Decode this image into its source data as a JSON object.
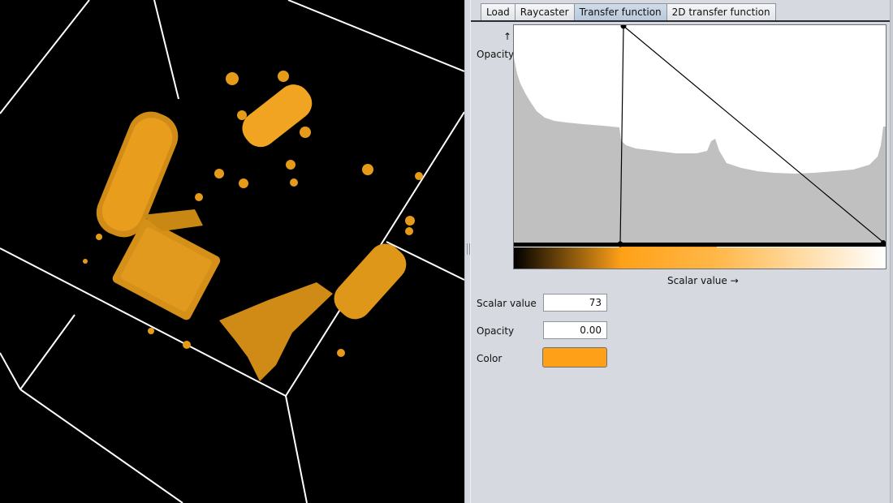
{
  "tabs": [
    {
      "label": "Load",
      "active": false
    },
    {
      "label": "Raycaster",
      "active": false
    },
    {
      "label": "Transfer function",
      "active": true
    },
    {
      "label": "2D transfer function",
      "active": false
    }
  ],
  "tf_editor": {
    "y_arrow": "↑",
    "y_label": "Opacity",
    "x_label": "Scalar value →"
  },
  "controls": {
    "scalar_label": "Scalar value",
    "scalar_value": "73",
    "opacity_label": "Opacity",
    "opacity_value": "0.00",
    "color_label": "Color",
    "color_hex": "#ffa118"
  },
  "colors": {
    "volume": "#e69a1a",
    "histogram": "#c0c0c0",
    "background": "#d6d9df"
  }
}
